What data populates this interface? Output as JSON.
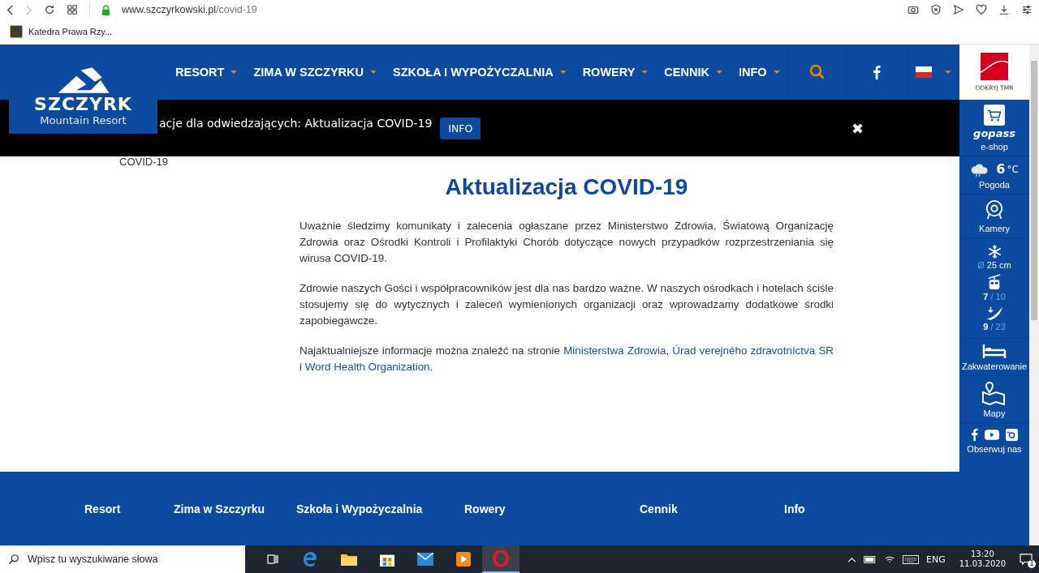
{
  "browser": {
    "url_host": "www.szczyrkowski.pl",
    "url_path": "/covid-19",
    "bookmarks": [
      "Katedra Prawa Rzy..."
    ]
  },
  "header": {
    "logo": {
      "name": "SZCZYRK",
      "tagline": "Mountain Resort"
    },
    "nav": [
      {
        "label": "RESORT"
      },
      {
        "label": "ZIMA W SZCZYRKU"
      },
      {
        "label": "SZKOŁA I WYPOŻYCZALNIA"
      },
      {
        "label": "ROWERY"
      },
      {
        "label": "CENNIK"
      },
      {
        "label": "INFO"
      }
    ],
    "partner": "ODKRYJ TMR"
  },
  "banner": {
    "text": "acje dla odwiedzających: Aktualizacja COVID-19",
    "button": "INFO",
    "close": "✖"
  },
  "breadcrumb": "COVID-19",
  "article": {
    "title": "Aktualizacja COVID-19",
    "paragraphs": [
      [
        {
          "text": "Uważnie śledzimy komunikaty i zalecenia ogłaszane przez Ministerstwo Zdrowia, Światową Organizację Zdrowia oraz Ośrodki Kontroli i Profilaktyki Chorób dotyczące nowych przypadków rozprzestrzeniania się wirusa COVID-19.",
          "link": false
        }
      ],
      [
        {
          "text": "Zdrowie naszych Gości i współpracowników jest dla nas bardzo ważne. W naszych ośrodkach i hotelach ściśle stosujemy się do wytycznych i zaleceń wymienionych organizacji oraz wprowadzamy dodatkowe środki zapobiegawcze.",
          "link": false
        }
      ],
      [
        {
          "text": "Najaktualniejsze informacje można znaleźć na stronie ",
          "link": false
        },
        {
          "text": "Ministerstwa Zdrowia",
          "link": true
        },
        {
          "text": ", ",
          "link": false
        },
        {
          "text": "Úrad verejného zdravotníctva SR",
          "link": true
        },
        {
          "text": " i ",
          "link": false
        },
        {
          "text": "Word Health Organization",
          "link": true
        },
        {
          "text": ".",
          "link": false
        }
      ]
    ]
  },
  "sidebar": [
    {
      "kind": "shop",
      "brand": "gopass",
      "label": "e-shop"
    },
    {
      "kind": "weather",
      "value": "6",
      "unit": "°C",
      "label": "Pogoda"
    },
    {
      "kind": "camera",
      "label": "Kamery"
    },
    {
      "kind": "snow",
      "prefix": "Ø",
      "value": "25 cm"
    },
    {
      "kind": "lifts",
      "value": "7",
      "total": "/ 10"
    },
    {
      "kind": "slopes",
      "value": "9",
      "total": "/ 23"
    },
    {
      "kind": "bed",
      "label": "Zakwaterowanie"
    },
    {
      "kind": "map",
      "label": "Mapy"
    },
    {
      "kind": "social",
      "label": "Obserwuj nas"
    }
  ],
  "footer": {
    "columns": [
      "Resort",
      "Zima w Szczyrku",
      "Szkoła i Wypożyczalnia",
      "Rowery",
      "Cennik",
      "Info"
    ]
  },
  "taskbar": {
    "search_placeholder": "Wpisz tu wyszukiwane słowa",
    "language": "ENG",
    "time": "13:20",
    "date": "11.03.2020",
    "notifications": "1"
  }
}
